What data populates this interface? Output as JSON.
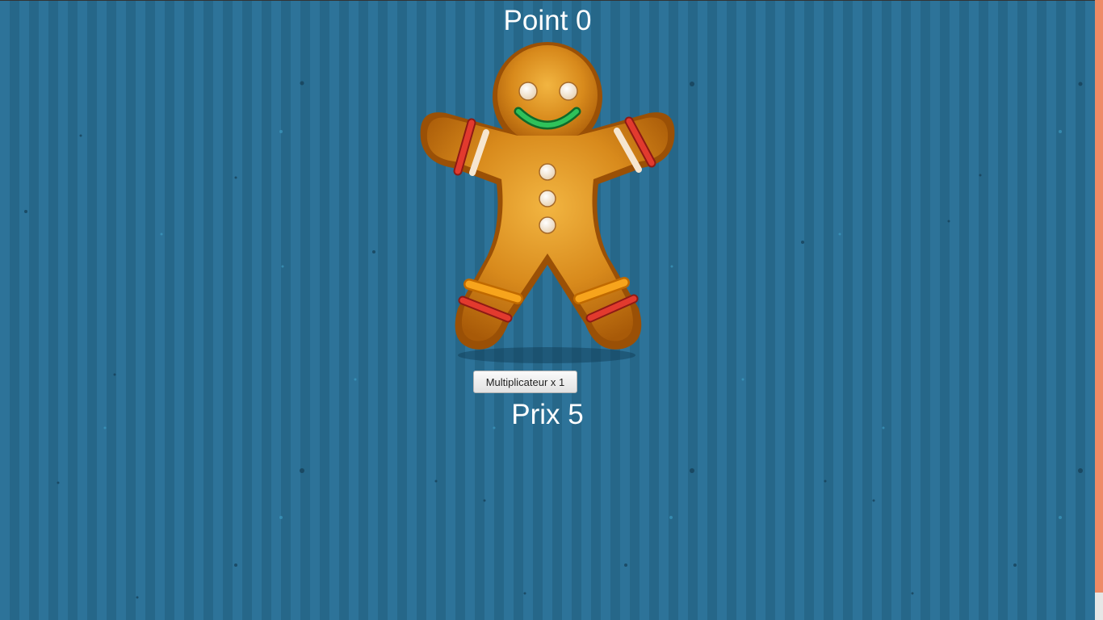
{
  "game": {
    "score_label": "Point 0",
    "upgrade_button_label": "Multiplicateur x 1",
    "price_label": "Prix 5"
  },
  "colors": {
    "background": "#2a6e94",
    "cookie_body": "#d88a1c",
    "scrollbar": "#ee8a66",
    "text": "#ffffff"
  },
  "icons": {
    "clickable_target": "gingerbread-man-icon"
  }
}
